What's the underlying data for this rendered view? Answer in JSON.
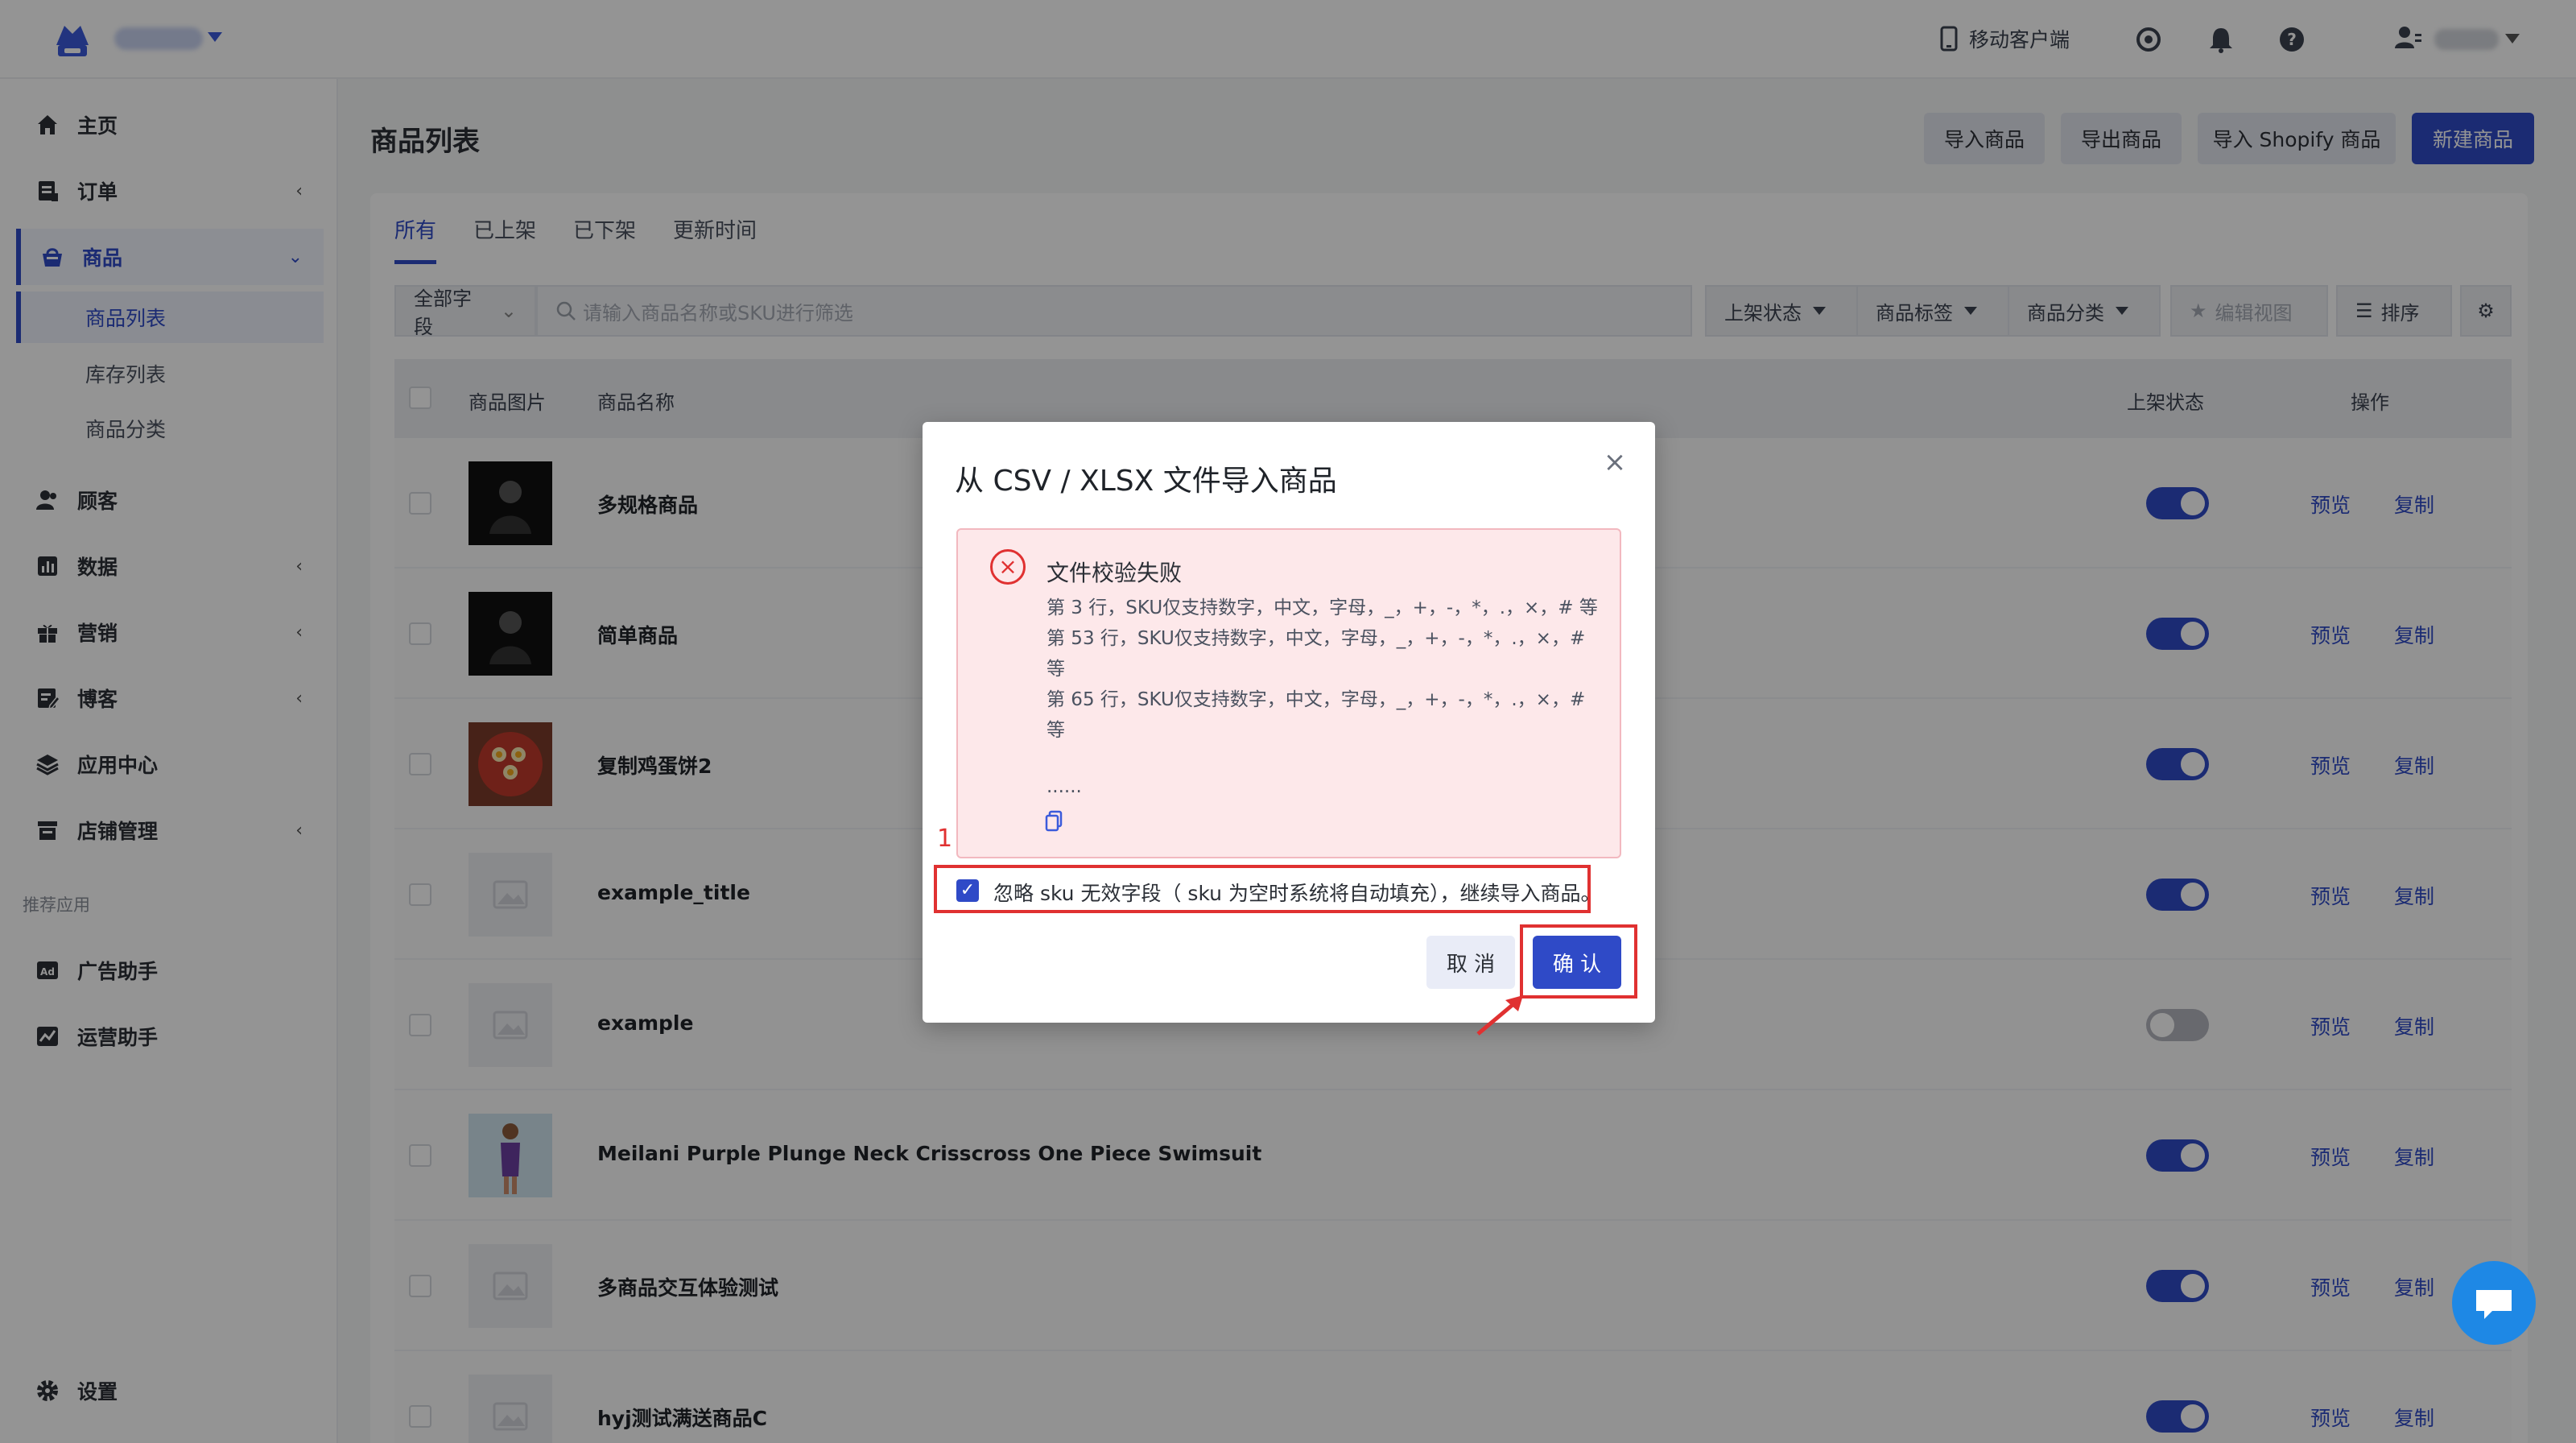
{
  "topbar": {
    "mobile_client": "移动客户端"
  },
  "sidebar": {
    "items": [
      {
        "label": "主页",
        "icon": "home-icon"
      },
      {
        "label": "订单",
        "icon": "order-icon"
      },
      {
        "label": "商品",
        "icon": "shop-icon"
      },
      {
        "label": "顾客",
        "icon": "customer-icon"
      },
      {
        "label": "数据",
        "icon": "chart-icon"
      },
      {
        "label": "营销",
        "icon": "gift-icon"
      },
      {
        "label": "博客",
        "icon": "blog-icon"
      },
      {
        "label": "应用中心",
        "icon": "layers-icon"
      },
      {
        "label": "店铺管理",
        "icon": "store-icon"
      },
      {
        "label": "广告助手",
        "icon": "ad-icon"
      },
      {
        "label": "运营助手",
        "icon": "ops-icon"
      },
      {
        "label": "设置",
        "icon": "gear-icon"
      }
    ],
    "sub_items": [
      "商品列表",
      "库存列表",
      "商品分类"
    ],
    "section_label": "推荐应用"
  },
  "header": {
    "title": "商品列表",
    "buttons": {
      "import": "导入商品",
      "export": "导出商品",
      "import_shopify": "导入 Shopify 商品",
      "new": "新建商品"
    }
  },
  "tabs": [
    "所有",
    "已上架",
    "已下架",
    "更新时间"
  ],
  "filters": {
    "field": "全部字段",
    "search_placeholder": "请输入商品名称或SKU进行筛选",
    "status": "上架状态",
    "tag": "商品标签",
    "category": "商品分类",
    "edit_view": "编辑视图",
    "sort": "排序"
  },
  "table": {
    "columns": [
      "商品图片",
      "商品名称",
      "上架状态",
      "操作"
    ],
    "rows": [
      {
        "name": "多规格商品",
        "on": true
      },
      {
        "name": "简单商品",
        "on": true
      },
      {
        "name": "复制鸡蛋饼2",
        "on": true
      },
      {
        "name": "example_title",
        "on": true
      },
      {
        "name": "example",
        "on": false
      },
      {
        "name": "Meilani Purple Plunge Neck Crisscross One Piece Swimsuit",
        "on": true
      },
      {
        "name": "多商品交互体验测试",
        "on": true
      },
      {
        "name": "hyj测试满送商品C",
        "on": true
      }
    ],
    "action_preview": "预览",
    "action_copy": "复制"
  },
  "modal": {
    "title": "从 CSV / XLSX 文件导入商品",
    "error_title": "文件校验失败",
    "error_lines": [
      "第 3 行，SKU仅支持数字，中文，字母，_，+，-，*，.，×，# 等",
      "第 53 行，SKU仅支持数字，中文，字母，_，+，-，*，.，×，# 等",
      "第 65 行，SKU仅支持数字，中文，字母，_，+，-，*，.，×，# 等"
    ],
    "ellipsis": "......",
    "annotation_number": "1",
    "checkbox_label": "忽略 sku 无效字段（ sku 为空时系统将自动填充），继续导入商品。",
    "cancel": "取 消",
    "confirm": "确 认"
  },
  "colors": {
    "primary": "#2f4ac7",
    "error": "#e03131",
    "error_bg": "#fde8ea"
  }
}
